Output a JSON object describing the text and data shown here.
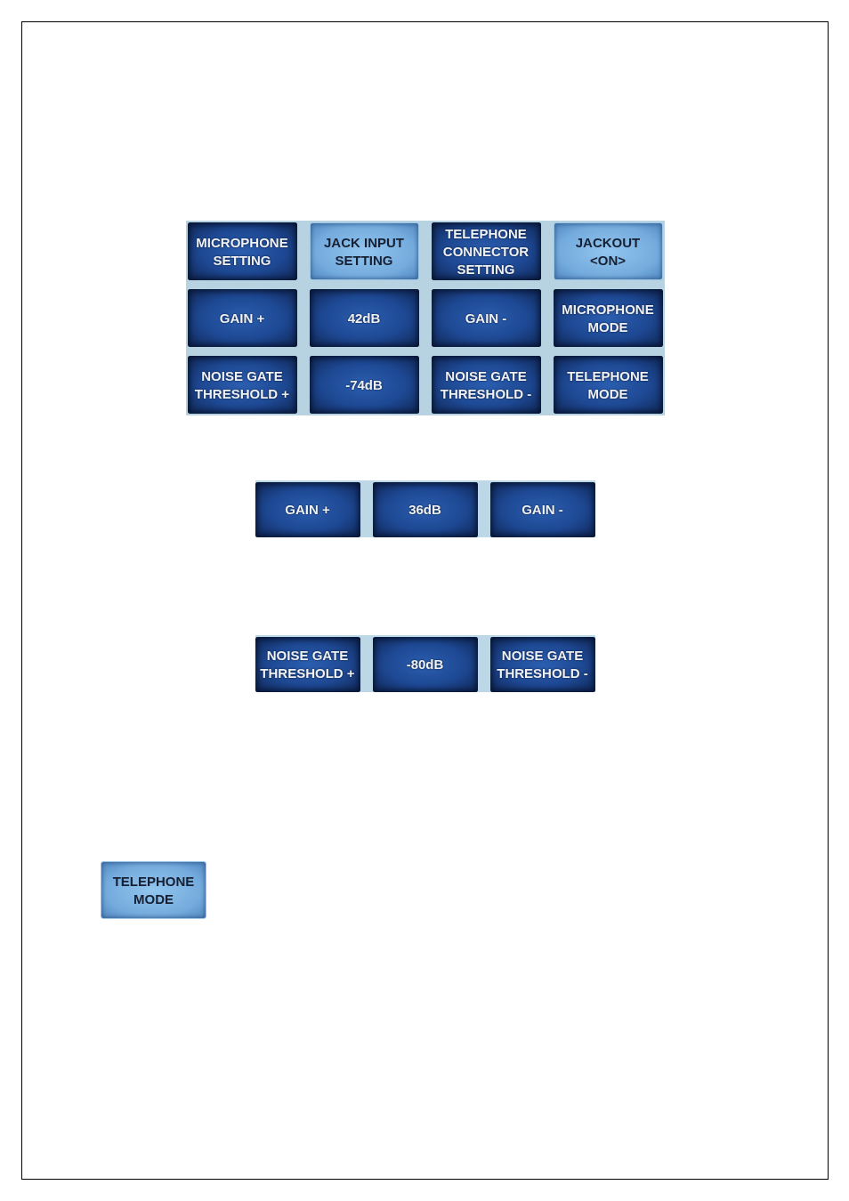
{
  "panels": [
    {
      "kind": "grid",
      "buttons": [
        {
          "label": "MICROPHONE\nSETTING",
          "selected": false
        },
        {
          "label": "JACK INPUT\nSETTING",
          "selected": true
        },
        {
          "label": "TELEPHONE\nCONNECTOR\nSETTING",
          "selected": false
        },
        {
          "label": "JACKOUT\n<ON>",
          "selected": true
        },
        {
          "label": "GAIN +",
          "selected": false
        },
        {
          "label": "42dB",
          "selected": false
        },
        {
          "label": "GAIN -",
          "selected": false
        },
        {
          "label": "MICROPHONE\nMODE",
          "selected": false
        },
        {
          "label": "NOISE GATE\nTHRESHOLD +",
          "selected": false
        },
        {
          "label": "-74dB",
          "selected": false
        },
        {
          "label": "NOISE GATE\nTHRESHOLD -",
          "selected": false
        },
        {
          "label": "TELEPHONE\nMODE",
          "selected": false
        }
      ]
    },
    {
      "kind": "strip",
      "buttons": [
        {
          "label": "GAIN +",
          "selected": false
        },
        {
          "label": "36dB",
          "selected": false
        },
        {
          "label": "GAIN -",
          "selected": false
        }
      ]
    },
    {
      "kind": "strip",
      "buttons": [
        {
          "label": "NOISE GATE\nTHRESHOLD +",
          "selected": false
        },
        {
          "label": "-80dB",
          "selected": false
        },
        {
          "label": "NOISE GATE\nTHRESHOLD -",
          "selected": false
        }
      ]
    },
    {
      "kind": "single",
      "buttons": [
        {
          "label": "TELEPHONE\nMODE",
          "selected": true
        }
      ]
    }
  ]
}
